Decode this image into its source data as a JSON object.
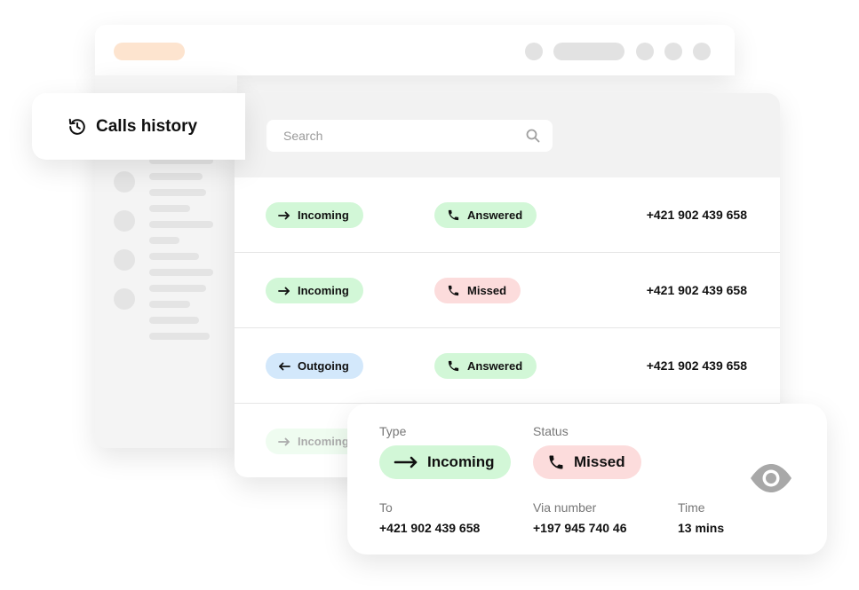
{
  "tab": {
    "title": "Calls history",
    "icon": "history-icon"
  },
  "search": {
    "placeholder": "Search",
    "icon": "search-icon"
  },
  "rows": [
    {
      "type": "Incoming",
      "type_icon": "arrow-right-icon",
      "status": "Answered",
      "status_icon": "phone-icon",
      "number": "+421 902 439 658"
    },
    {
      "type": "Incoming",
      "type_icon": "arrow-right-icon",
      "status": "Missed",
      "status_icon": "phone-icon",
      "number": "+421 902 439 658"
    },
    {
      "type": "Outgoing",
      "type_icon": "arrow-left-icon",
      "status": "Answered",
      "status_icon": "phone-icon",
      "number": "+421 902 439 658"
    },
    {
      "type": "Incoming",
      "type_icon": "arrow-right-icon"
    }
  ],
  "detail": {
    "type_label": "Type",
    "type_value": "Incoming",
    "status_label": "Status",
    "status_value": "Missed",
    "to_label": "To",
    "to_value": "+421 902 439 658",
    "via_label": "Via number",
    "via_value": "+197 945 740 46",
    "time_label": "Time",
    "time_value": "13 mins",
    "view_icon": "eye-icon"
  },
  "colors": {
    "incoming_answered_bg": "#d2f7d7",
    "missed_bg": "#fcdcdc",
    "outgoing_bg": "#d3e8fb",
    "placeholder_accent": "#fde4cf"
  }
}
